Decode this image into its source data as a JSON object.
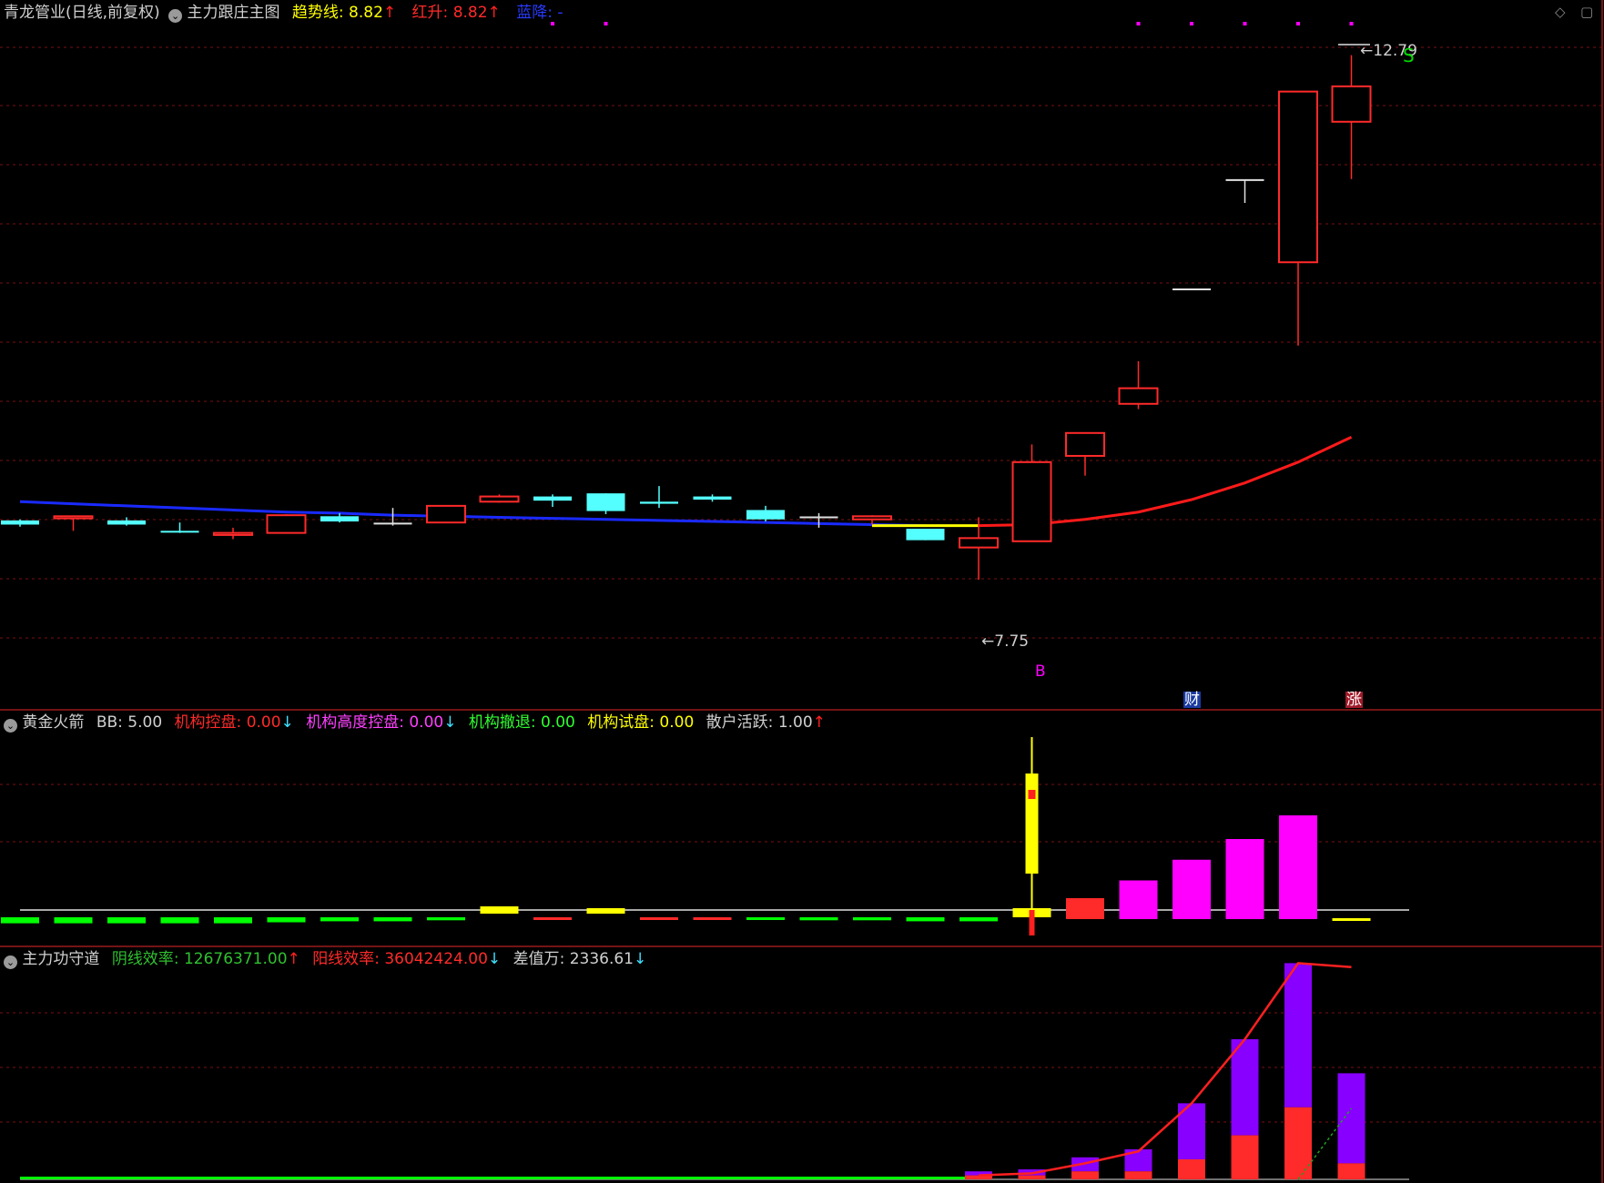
{
  "main": {
    "title": "青龙管业(日线,前复权)",
    "indicator": "主力跟庄主图",
    "trend_label": "趋势线",
    "trend_value": "8.82",
    "red_label": "红升",
    "red_value": "8.82",
    "blue_label": "蓝降",
    "blue_value": "-",
    "high_label": "12.79",
    "low_label": "7.75",
    "marker_b": "B",
    "marker_s": "S",
    "badge_cai": "财",
    "badge_zhang": "涨"
  },
  "panel2": {
    "name": "黄金火箭",
    "bb_label": "BB",
    "bb_value": "5.00",
    "f1_label": "机构控盘",
    "f1_value": "0.00",
    "f2_label": "机构高度控盘",
    "f2_value": "0.00",
    "f3_label": "机构撤退",
    "f3_value": "0.00",
    "f4_label": "机构试盘",
    "f4_value": "0.00",
    "f5_label": "散户活跃",
    "f5_value": "1.00"
  },
  "panel3": {
    "name": "主力功守道",
    "f1_label": "阴线效率",
    "f1_value": "12676371.00",
    "f2_label": "阳线效率",
    "f2_value": "36042424.00",
    "f3_label": "差值万",
    "f3_value": "2336.61"
  },
  "colors": {
    "up": "#ff2a2a",
    "down": "#54ffff",
    "trend_blue": "#1a2aff",
    "trend_yellow": "#ffff00",
    "trend_red": "#ff1a1a",
    "magenta": "#ff00ff",
    "purple": "#8800ff",
    "green": "#00ff00",
    "grid": "#7a1010"
  },
  "chart_data": [
    {
      "type": "candlestick",
      "title": "主力跟庄主图",
      "candles": [
        {
          "o": 8.32,
          "h": 8.33,
          "l": 8.26,
          "c": 8.28
        },
        {
          "o": 8.34,
          "h": 8.36,
          "l": 8.22,
          "c": 8.36
        },
        {
          "o": 8.32,
          "h": 8.35,
          "l": 8.27,
          "c": 8.28
        },
        {
          "o": 8.22,
          "h": 8.3,
          "l": 8.2,
          "c": 8.21
        },
        {
          "o": 8.18,
          "h": 8.25,
          "l": 8.14,
          "c": 8.2
        },
        {
          "o": 8.2,
          "h": 8.38,
          "l": 8.2,
          "c": 8.37
        },
        {
          "o": 8.36,
          "h": 8.39,
          "l": 8.3,
          "c": 8.31
        },
        {
          "o": 8.29,
          "h": 8.44,
          "l": 8.27,
          "c": 8.29
        },
        {
          "o": 8.3,
          "h": 8.46,
          "l": 8.3,
          "c": 8.46
        },
        {
          "o": 8.5,
          "h": 8.57,
          "l": 8.49,
          "c": 8.55
        },
        {
          "o": 8.55,
          "h": 8.57,
          "l": 8.45,
          "c": 8.51
        },
        {
          "o": 8.58,
          "h": 8.58,
          "l": 8.38,
          "c": 8.41
        },
        {
          "o": 8.5,
          "h": 8.65,
          "l": 8.44,
          "c": 8.48
        },
        {
          "o": 8.55,
          "h": 8.57,
          "l": 8.5,
          "c": 8.52
        },
        {
          "o": 8.42,
          "h": 8.46,
          "l": 8.31,
          "c": 8.33
        },
        {
          "o": 8.35,
          "h": 8.39,
          "l": 8.25,
          "c": 8.35
        },
        {
          "o": 8.33,
          "h": 8.37,
          "l": 8.28,
          "c": 8.36
        },
        {
          "o": 8.24,
          "h": 8.24,
          "l": 8.13,
          "c": 8.13
        },
        {
          "o": 8.06,
          "h": 8.35,
          "l": 7.75,
          "c": 8.15
        },
        {
          "o": 8.12,
          "h": 9.05,
          "l": 8.12,
          "c": 8.88
        },
        {
          "o": 8.94,
          "h": 9.16,
          "l": 8.75,
          "c": 9.16
        },
        {
          "o": 9.44,
          "h": 9.85,
          "l": 9.39,
          "c": 9.59
        },
        {
          "o": 10.54,
          "h": 10.54,
          "l": 10.54,
          "c": 10.54
        },
        {
          "o": 11.59,
          "h": 11.59,
          "l": 11.37,
          "c": 11.59
        },
        {
          "o": 10.8,
          "h": 12.44,
          "l": 10.0,
          "c": 12.44
        },
        {
          "o": 12.15,
          "h": 12.79,
          "l": 11.6,
          "c": 12.49
        }
      ],
      "series": [
        {
          "name": "蓝降",
          "color": "blue",
          "values": [
            8.5,
            8.48,
            8.46,
            8.44,
            8.42,
            8.4,
            8.39,
            8.37,
            8.36,
            8.35,
            8.34,
            8.33,
            8.32,
            8.31,
            8.3,
            8.29,
            8.28,
            8.27,
            null,
            null,
            null,
            null,
            null,
            null,
            null,
            null
          ]
        },
        {
          "name": "趋势线",
          "color": "red",
          "values": [
            null,
            null,
            null,
            null,
            null,
            null,
            null,
            null,
            null,
            null,
            null,
            null,
            null,
            null,
            null,
            null,
            null,
            null,
            8.27,
            8.28,
            8.33,
            8.4,
            8.52,
            8.68,
            8.88,
            9.12
          ]
        }
      ],
      "pink_dots_at": [
        10,
        11,
        21,
        22,
        23,
        24,
        25
      ],
      "ylim": [
        7.2,
        12.9
      ]
    },
    {
      "type": "bar",
      "title": "黄金火箭",
      "values": [
        -0.3,
        -0.3,
        -0.3,
        -0.3,
        -0.3,
        -0.25,
        -0.2,
        -0.2,
        -0.15,
        0.1,
        -0.05,
        0.05,
        -0.05,
        -0.05,
        -0.1,
        -0.15,
        -0.15,
        -0.2,
        -0.2,
        0,
        0.2,
        0.5,
        0.85,
        1.2,
        1.6,
        0
      ],
      "rocket_at": 19
    },
    {
      "type": "bar",
      "title": "主力功守道",
      "purple": [
        0,
        0,
        0,
        0,
        0,
        0,
        0,
        0,
        0,
        0,
        0,
        0,
        0,
        0,
        0,
        0,
        0,
        0,
        0.1,
        0.15,
        0.35,
        0.55,
        1.4,
        2.4,
        3.6,
        2.25
      ],
      "red": [
        0,
        0,
        0,
        0,
        0,
        0,
        0,
        0,
        0,
        0,
        0,
        0,
        0,
        0,
        0,
        0,
        0,
        0,
        0.1,
        0.1,
        0.2,
        0.2,
        0.5,
        1.1,
        1.8,
        0.4
      ],
      "line": [
        0,
        0,
        0,
        0,
        0,
        0,
        0,
        0,
        0,
        0,
        0,
        0,
        0,
        0,
        0,
        0,
        0,
        0,
        0.1,
        0.15,
        0.4,
        0.7,
        1.9,
        3.5,
        5.4,
        5.3
      ]
    }
  ]
}
